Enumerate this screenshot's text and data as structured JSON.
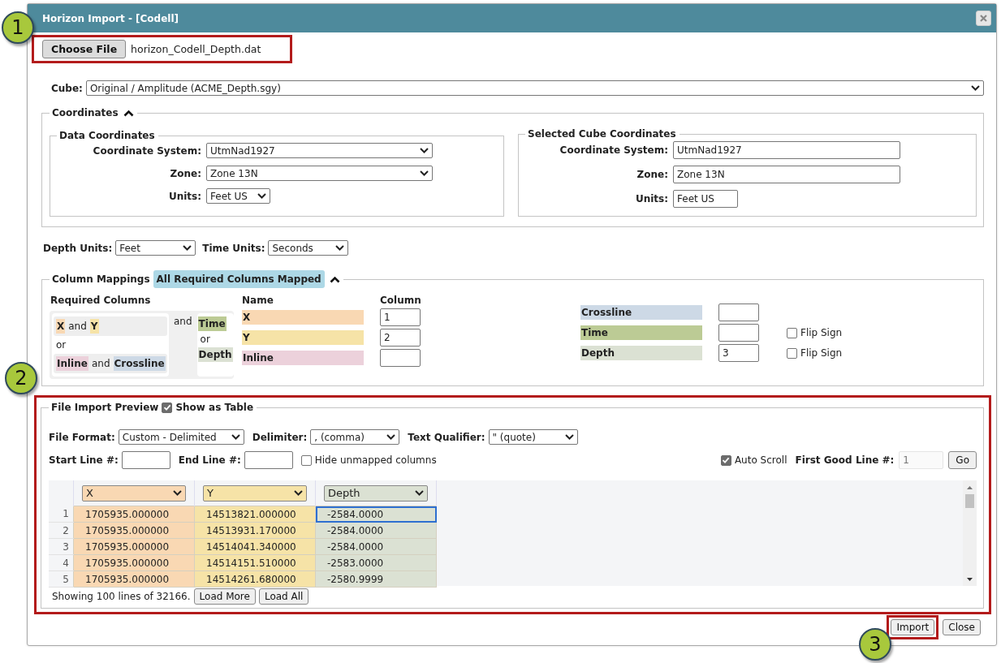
{
  "window": {
    "title": "Horizon Import - [Codell]"
  },
  "callouts": [
    {
      "label": "1"
    },
    {
      "label": "2"
    },
    {
      "label": "3"
    }
  ],
  "file": {
    "button": "Choose File",
    "file_name": "horizon_Codell_Depth.dat",
    "highlighted": true
  },
  "cube": {
    "label": "Cube:",
    "value": "Original / Amplitude (ACME_Depth.sgy)"
  },
  "coordinates": {
    "title": "Coordinates",
    "expanded": true,
    "data_coordinates": {
      "title": "Data Coordinates",
      "fields": [
        {
          "label": "Coordinate System:",
          "value": "UtmNad1927",
          "kind": "select"
        },
        {
          "label": "Zone:",
          "value": "Zone 13N",
          "kind": "select"
        },
        {
          "label": "Units:",
          "value": "Feet US",
          "kind": "select"
        }
      ]
    },
    "selected_cube_coordinates": {
      "title": "Selected Cube Coordinates",
      "fields": [
        {
          "label": "Coordinate System:",
          "value": "UtmNad1927",
          "kind": "text"
        },
        {
          "label": "Zone:",
          "value": "Zone 13N",
          "kind": "text"
        },
        {
          "label": "Units:",
          "value": "Feet US",
          "kind": "text"
        }
      ]
    }
  },
  "units": [
    {
      "label": "Depth Units:",
      "value": "Feet"
    },
    {
      "label": "Time Units:",
      "value": "Seconds"
    }
  ],
  "column_mappings": {
    "title": "Column Mappings",
    "status": "All Required Columns Mapped",
    "expanded": true,
    "required": {
      "title": "Required Columns",
      "joiner": "and",
      "position_separator": "or",
      "domain_separator": "or",
      "position_options": [
        {
          "parts": [
            {
              "kind": "tag",
              "text": "X",
              "color": "#f9d8b3"
            },
            {
              "kind": "word",
              "text": "and"
            },
            {
              "kind": "tag",
              "text": "Y",
              "color": "#f6e3a7"
            }
          ]
        },
        {
          "parts": [
            {
              "kind": "tag",
              "text": "Inline",
              "color": "#ecd1db"
            },
            {
              "kind": "word",
              "text": "and"
            },
            {
              "kind": "tag",
              "text": "Crossline",
              "color": "#cdd9e6"
            }
          ]
        }
      ],
      "domain_options": [
        {
          "text": "Time",
          "color": "#bccb95"
        },
        {
          "text": "Depth",
          "color": "#dbe1d3"
        }
      ]
    },
    "name_header": "Name",
    "column_header": "Column",
    "left_mappings": [
      {
        "name": "X",
        "color": "#f9d8b3",
        "column": "1"
      },
      {
        "name": "Y",
        "color": "#f6e3a7",
        "column": "2"
      },
      {
        "name": "Inline",
        "color": "#ecd1db"
      }
    ],
    "right_mappings": [
      {
        "name": "Crossline",
        "color": "#cdd9e6"
      },
      {
        "name": "Time",
        "color": "#bccb95",
        "flip_sign": {
          "label": "Flip Sign",
          "checked": false
        }
      },
      {
        "name": "Depth",
        "color": "#dbe1d3",
        "column": "3",
        "flip_sign": {
          "label": "Flip Sign",
          "checked": false
        }
      }
    ]
  },
  "preview": {
    "title": "File Import Preview",
    "highlighted": true,
    "show_table": {
      "label": "Show as Table",
      "checked": true
    },
    "file_format": {
      "label": "File Format:",
      "value": "Custom - Delimited"
    },
    "delimiter": {
      "label": "Delimiter:",
      "value": ", (comma)"
    },
    "text_qualifier": {
      "label": "Text Qualifier:",
      "value": "\" (quote)"
    },
    "start_line": {
      "label": "Start Line #:"
    },
    "end_line": {
      "label": "End Line #:"
    },
    "hide_unmapped": {
      "label": "Hide unmapped columns",
      "checked": false
    },
    "auto_scroll": {
      "label": "Auto Scroll",
      "checked": true
    },
    "first_good_line": {
      "label": "First Good Line #:",
      "placeholder": "1",
      "disabled": true
    },
    "go_button": "Go",
    "table": {
      "columns": [
        {
          "header": "X",
          "color": "#f9d8b3"
        },
        {
          "header": "Y",
          "color": "#f6e3a7"
        },
        {
          "header": "Depth",
          "color": "#dbe1d3"
        }
      ],
      "rows": [
        {
          "number": "1",
          "cells": [
            {
              "text": "1705935.000000",
              "focused": false
            },
            {
              "text": "14513821.000000",
              "focused": false
            },
            {
              "text": "-2584.0000",
              "focused": true
            }
          ]
        },
        {
          "number": "2",
          "cells": [
            {
              "text": "1705935.000000",
              "focused": false
            },
            {
              "text": "14513931.170000",
              "focused": false
            },
            {
              "text": "-2584.0000",
              "focused": false
            }
          ]
        },
        {
          "number": "3",
          "cells": [
            {
              "text": "1705935.000000",
              "focused": false
            },
            {
              "text": "14514041.340000",
              "focused": false
            },
            {
              "text": "-2584.0000",
              "focused": false
            }
          ]
        },
        {
          "number": "4",
          "cells": [
            {
              "text": "1705935.000000",
              "focused": false
            },
            {
              "text": "14514151.510000",
              "focused": false
            },
            {
              "text": "-2583.0000",
              "focused": false
            }
          ]
        },
        {
          "number": "5",
          "cells": [
            {
              "text": "1705935.000000",
              "focused": false
            },
            {
              "text": "14514261.680000",
              "focused": false
            },
            {
              "text": "-2580.9999",
              "focused": false
            }
          ]
        }
      ]
    },
    "summary": "Showing 100 lines of 32166.",
    "buttons": [
      "Load More",
      "Load All"
    ]
  },
  "buttons": [
    {
      "label": "Import",
      "highlighted": true
    },
    {
      "label": "Close",
      "highlighted": false
    }
  ]
}
